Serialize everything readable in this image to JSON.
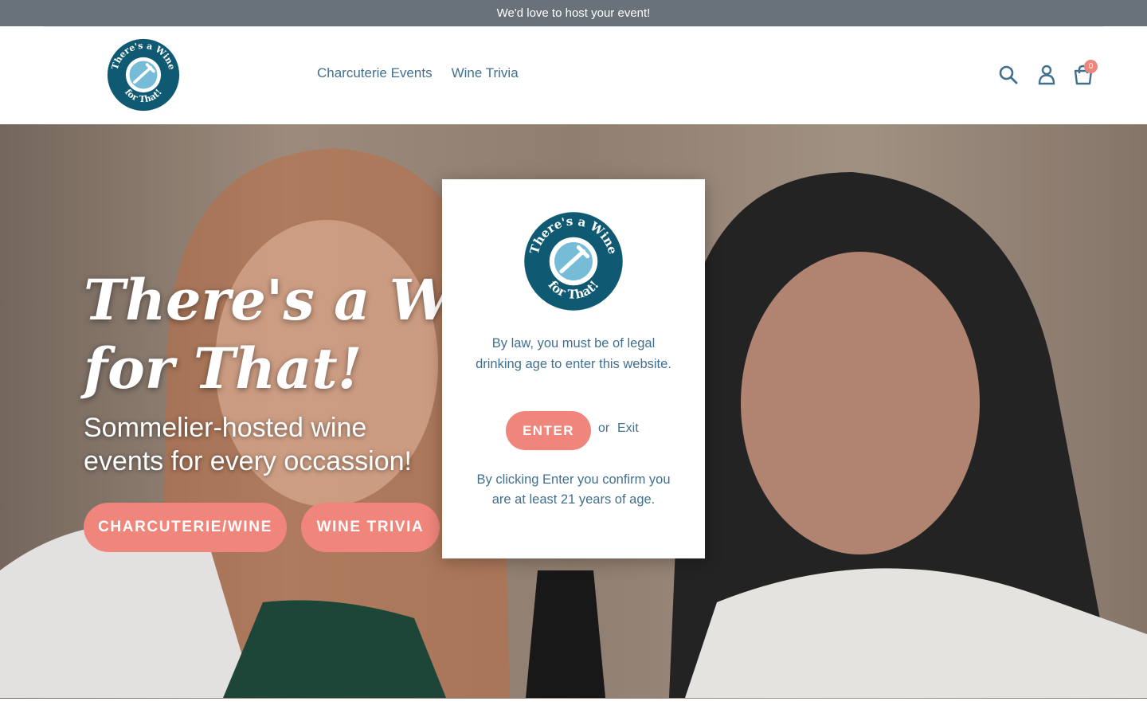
{
  "announcement": {
    "text": "We'd love to host your event!"
  },
  "brand": {
    "logo_top": "There's a Wine",
    "logo_bottom": "for That!",
    "logo_primary": "#0f5a72",
    "logo_accent": "#76bcd6"
  },
  "nav": {
    "items": [
      {
        "label": "Charcuterie Events"
      },
      {
        "label": "Wine Trivia"
      }
    ]
  },
  "header_icons": {
    "search": "search-icon",
    "account": "user-icon",
    "cart": "cart-icon",
    "cart_count": "0"
  },
  "hero": {
    "title_line1": "There's a Wine",
    "title_line2": "for That!",
    "subtitle": "Sommelier-hosted wine events for every occassion!",
    "buttons": [
      {
        "label": "CHARCUTERIE/WINE"
      },
      {
        "label": "WINE TRIVIA"
      }
    ]
  },
  "age_gate": {
    "message": "By law, you must be of legal drinking age to enter this website.",
    "enter_label": "ENTER",
    "or_text": "or",
    "exit_label": "Exit",
    "footer": "By clicking Enter you confirm you are at least 21 years of age."
  },
  "colors": {
    "announcement_bg": "#69727b",
    "nav_link": "#41708f",
    "accent": "#ef857b",
    "hero_text": "#ffffff"
  }
}
